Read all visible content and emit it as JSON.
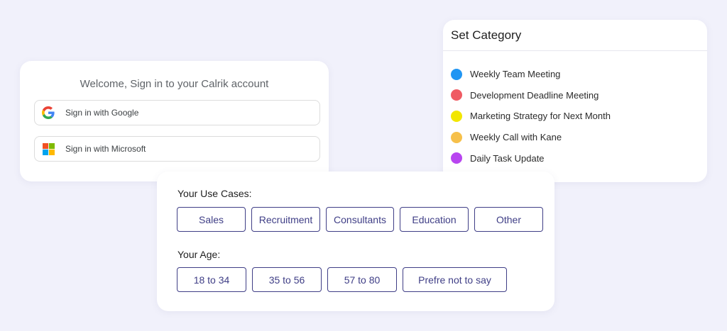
{
  "signin": {
    "title": "Welcome, Sign in to your Calrik account",
    "google_label": "Sign in with Google",
    "microsoft_label": "Sign in with Microsoft"
  },
  "category": {
    "title": "Set Category",
    "items": [
      {
        "label": "Weekly Team Meeting",
        "color": "#2196f3"
      },
      {
        "label": "Development Deadline Meeting",
        "color": "#ef5b63"
      },
      {
        "label": "Marketing Strategy for Next Month",
        "color": "#f2e600"
      },
      {
        "label": "Weekly Call with Kane",
        "color": "#f6c04a"
      },
      {
        "label": "Daily Task Update",
        "color": "#b845f0"
      }
    ]
  },
  "usecases": {
    "label": "Your Use Cases:",
    "options": [
      "Sales",
      "Recruitment",
      "Consultants",
      "Education",
      "Other"
    ]
  },
  "age": {
    "label": "Your Age:",
    "options": [
      "18 to 34",
      "35 to 56",
      "57 to 80",
      "Prefre not to say"
    ]
  },
  "colors": {
    "accent": "#3f3e86",
    "background": "#f1f1fb"
  },
  "icons": {
    "google": "google-logo-icon",
    "microsoft": "microsoft-logo-icon"
  }
}
